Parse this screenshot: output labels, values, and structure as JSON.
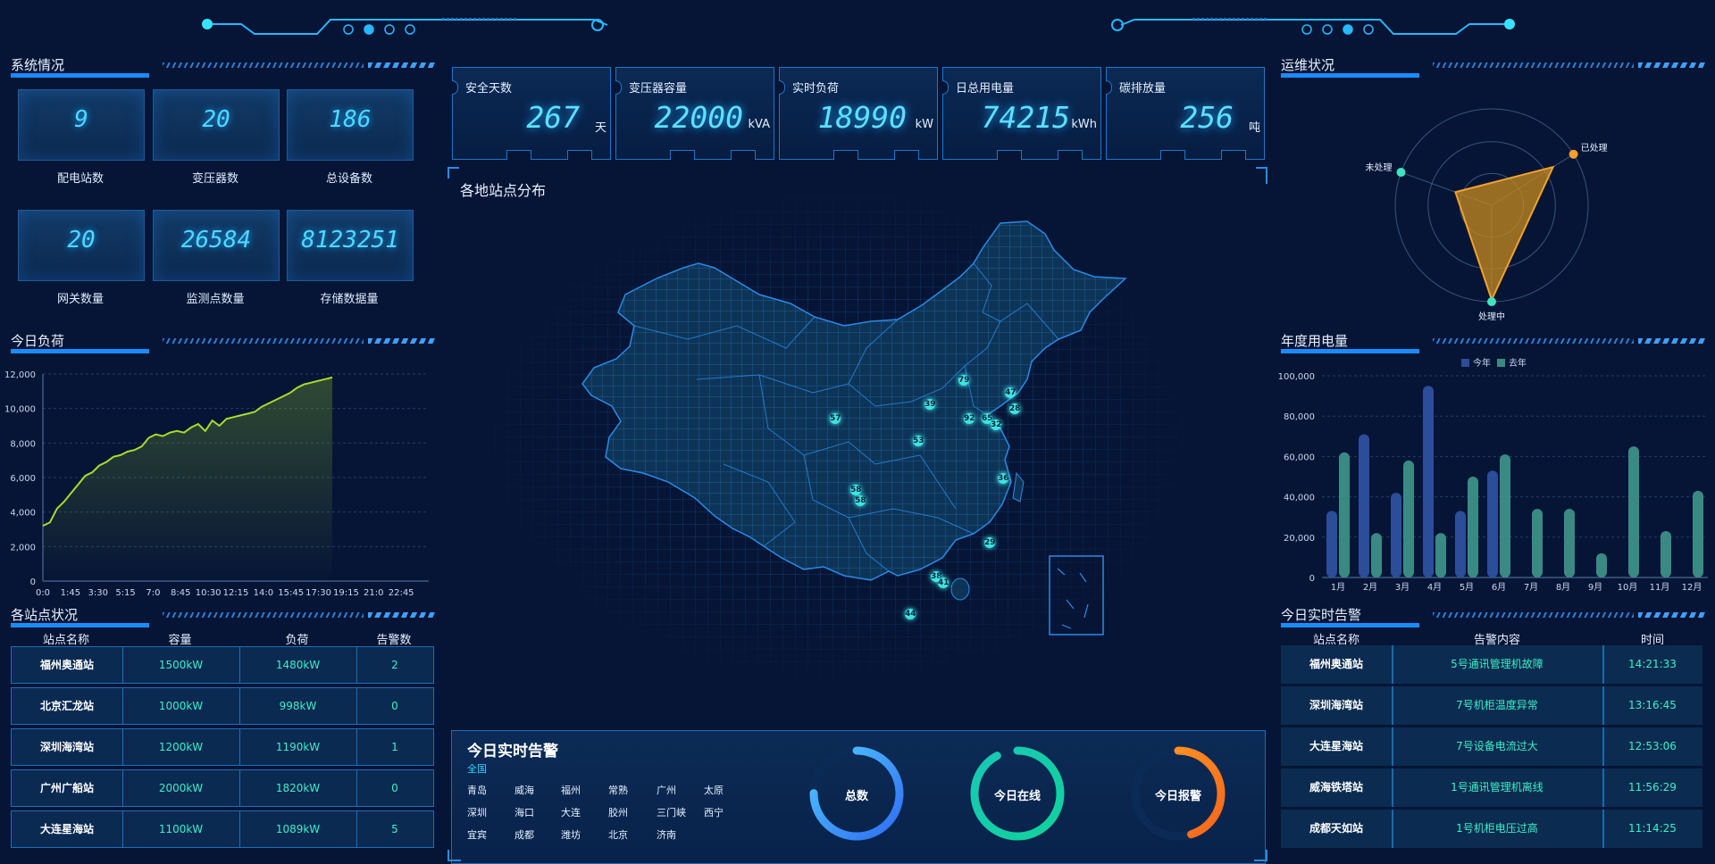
{
  "system": {
    "title": "系统情况",
    "stats": [
      {
        "value": "9",
        "label": "配电站数"
      },
      {
        "value": "20",
        "label": "变压器数"
      },
      {
        "value": "186",
        "label": "总设备数"
      },
      {
        "value": "20",
        "label": "网关数量"
      },
      {
        "value": "26584",
        "label": "监测点数量"
      },
      {
        "value": "8123251",
        "label": "存储数据量"
      }
    ]
  },
  "kpis": [
    {
      "label": "安全天数",
      "value": "267",
      "unit": "天"
    },
    {
      "label": "变压器容量",
      "value": "22000",
      "unit": "kVA"
    },
    {
      "label": "实时负荷",
      "value": "18990",
      "unit": "kW"
    },
    {
      "label": "日总用电量",
      "value": "74215",
      "unit": "kWh"
    },
    {
      "label": "碳排放量",
      "value": "256",
      "unit": "吨"
    }
  ],
  "load": {
    "title": "今日负荷",
    "chart_data": {
      "type": "area",
      "ylim": [
        0,
        12000
      ],
      "yticks": [
        "0",
        "2,000",
        "4,000",
        "6,000",
        "8,000",
        "10,000",
        "12,000"
      ],
      "xticks": [
        "0:0",
        "1:45",
        "3:30",
        "5:15",
        "7:0",
        "8:45",
        "10:30",
        "12:15",
        "14:0",
        "15:45",
        "17:30",
        "19:15",
        "21:0",
        "22:45"
      ],
      "points": [
        3200,
        3400,
        4200,
        4600,
        5100,
        5600,
        6100,
        6300,
        6700,
        6900,
        7200,
        7300,
        7500,
        7600,
        7800,
        8300,
        8500,
        8400,
        8600,
        8700,
        8600,
        8900,
        9100,
        8700,
        9300,
        9000,
        9400,
        9500,
        9600,
        9700,
        9800,
        10100,
        10300,
        10500,
        10700,
        10900,
        11200,
        11400,
        11500,
        11600,
        11700,
        11800
      ]
    }
  },
  "stations": {
    "title": "各站点状况",
    "headers": [
      "站点名称",
      "容量",
      "负荷",
      "告警数"
    ],
    "rows": [
      [
        "福州奥通站",
        "1500kW",
        "1480kW",
        "2"
      ],
      [
        "北京汇龙站",
        "1000kW",
        "998kW",
        "0"
      ],
      [
        "深圳海湾站",
        "1200kW",
        "1190kW",
        "1"
      ],
      [
        "广州广船站",
        "2000kW",
        "1820kW",
        "0"
      ],
      [
        "大连星海站",
        "1100kW",
        "1089kW",
        "5"
      ]
    ]
  },
  "map": {
    "title": "各地站点分布",
    "pins": [
      {
        "label": "79"
      },
      {
        "label": "47"
      },
      {
        "label": "28"
      },
      {
        "label": "39"
      },
      {
        "label": "92"
      },
      {
        "label": "65"
      },
      {
        "label": "32"
      },
      {
        "label": "57"
      },
      {
        "label": "53"
      },
      {
        "label": "36"
      },
      {
        "label": "58"
      },
      {
        "label": "58"
      },
      {
        "label": "29"
      },
      {
        "label": "38"
      },
      {
        "label": "41"
      },
      {
        "label": "44"
      }
    ]
  },
  "today_alarm_panel": {
    "title": "今日实时告警",
    "scope": "全国",
    "cities": [
      "青岛",
      "威海",
      "福州",
      "常熟",
      "广州",
      "太原",
      "深圳",
      "海口",
      "大连",
      "胶州",
      "三门峡",
      "西宁",
      "宜宾",
      "成都",
      "潍坊",
      "北京",
      "济南"
    ],
    "rings": [
      {
        "label": "总数",
        "color_a": "#2f6df2",
        "color_b": "#4fc8ff",
        "progress": 0.75
      },
      {
        "label": "今日在线",
        "color_a": "#10d29b",
        "color_b": "#18c8b5",
        "progress": 0.92
      },
      {
        "label": "今日报警",
        "color_a": "#f7651c",
        "color_b": "#ff9b25",
        "progress": 0.45
      }
    ]
  },
  "ops": {
    "title": "运维状况",
    "chart_data": {
      "type": "radar",
      "axes": [
        "已处理",
        "处理中",
        "未处理"
      ],
      "values": [
        0.75,
        0.98,
        0.4
      ]
    }
  },
  "annual": {
    "title": "年度用电量",
    "chart_data": {
      "type": "bar",
      "legend": [
        "今年",
        "去年"
      ],
      "ylim": [
        0,
        100000
      ],
      "yticks": [
        "0",
        "20,000",
        "40,000",
        "60,000",
        "80,000",
        "100,000"
      ],
      "categories": [
        "1月",
        "2月",
        "3月",
        "4月",
        "5月",
        "6月",
        "7月",
        "8月",
        "9月",
        "10月",
        "11月",
        "12月"
      ],
      "series": [
        {
          "name": "今年",
          "values": [
            33000,
            71000,
            42000,
            95000,
            33000,
            53000,
            null,
            null,
            null,
            null,
            null,
            null
          ]
        },
        {
          "name": "去年",
          "values": [
            62000,
            22000,
            58000,
            22000,
            50000,
            61000,
            34000,
            34000,
            12000,
            65000,
            23000,
            43000
          ]
        }
      ],
      "colors": {
        "今年": "#2c4d9a",
        "去年": "#3a8a84"
      }
    }
  },
  "alarms": {
    "title": "今日实时告警",
    "headers": [
      "站点名称",
      "告警内容",
      "时间"
    ],
    "rows": [
      [
        "福州奥通站",
        "5号通讯管理机故障",
        "14:21:33"
      ],
      [
        "深圳海湾站",
        "7号机柜温度异常",
        "13:16:45"
      ],
      [
        "大连星海站",
        "7号设备电流过大",
        "12:53:06"
      ],
      [
        "威海铁塔站",
        "1号通讯管理机离线",
        "11:56:29"
      ],
      [
        "成都天如站",
        "1号机柜电压过高",
        "11:14:25"
      ]
    ]
  }
}
